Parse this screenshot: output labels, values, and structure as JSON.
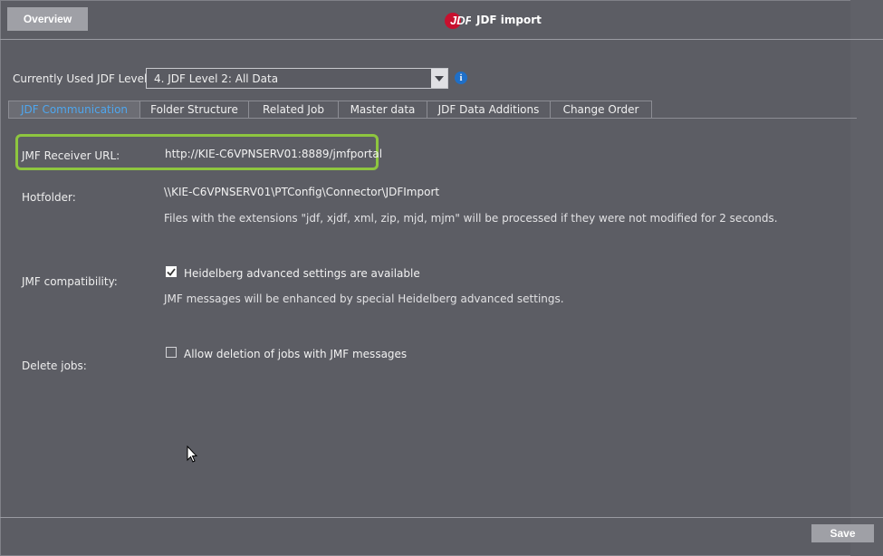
{
  "header": {
    "overview_label": "Overview",
    "title": "JDF import",
    "logo_icon": "jdf-logo-icon"
  },
  "jdf_level": {
    "label": "Currently Used JDF Level:",
    "selected": "4. JDF Level 2: All Data",
    "info_icon": "i"
  },
  "tabs": [
    {
      "label": "JDF Communication",
      "active": true
    },
    {
      "label": "Folder Structure",
      "active": false
    },
    {
      "label": "Related Job",
      "active": false
    },
    {
      "label": "Master data",
      "active": false
    },
    {
      "label": "JDF Data Additions",
      "active": false
    },
    {
      "label": "Change Order",
      "active": false
    }
  ],
  "jmf_receiver": {
    "label": "JMF Receiver URL:",
    "value": "http://KIE-C6VPNSERV01:8889/jmfportal"
  },
  "hotfolder": {
    "label": "Hotfolder:",
    "value": "\\\\KIE-C6VPNSERV01\\PTConfig\\Connector\\JDFImport",
    "note": "Files with the extensions \"jdf, xjdf, xml, zip, mjd, mjm\" will be processed if they were not modified for 2 seconds."
  },
  "jmf_compat": {
    "label": "JMF compatibility:",
    "checkbox_label": "Heidelberg advanced settings are available",
    "checked": true,
    "note": "JMF messages will be enhanced by special Heidelberg advanced settings."
  },
  "delete_jobs": {
    "label": "Delete jobs:",
    "checkbox_label": "Allow deletion of jobs with JMF messages",
    "checked": false
  },
  "footer": {
    "save_label": "Save"
  },
  "colors": {
    "background": "#5c5d64",
    "active_tab_text": "#4ea6ee",
    "highlight": "#8ec63f",
    "button": "#9fa0a6"
  }
}
